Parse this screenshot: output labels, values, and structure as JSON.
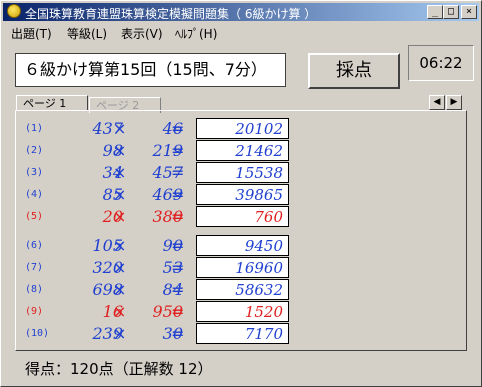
{
  "window": {
    "title": "全国珠算教育連盟珠算検定模擬問題集（ 6級かけ算 ）",
    "min_glyph": "_",
    "max_glyph": "□",
    "close_glyph": "×"
  },
  "menu": [
    "出題(T)",
    "等級(L)",
    "表示(V)",
    "ﾍﾙﾌﾟ(H)"
  ],
  "header": {
    "title": "６級かけ算第15回（15問、7分）",
    "score_button": "採点",
    "timer": "06:22"
  },
  "tabs": [
    {
      "label": "ページ 1",
      "active": true
    },
    {
      "label": "ページ 2",
      "active": false
    }
  ],
  "nav": {
    "left": "◀",
    "right": "▶"
  },
  "symbols": {
    "times": "×",
    "equals": "="
  },
  "problems": [
    {
      "num": "(1)",
      "a": "437",
      "b": "46",
      "answer": "20102",
      "color": "blue"
    },
    {
      "num": "(2)",
      "a": "98",
      "b": "219",
      "answer": "21462",
      "color": "blue"
    },
    {
      "num": "(3)",
      "a": "34",
      "b": "457",
      "answer": "15538",
      "color": "blue"
    },
    {
      "num": "(4)",
      "a": "85",
      "b": "469",
      "answer": "39865",
      "color": "blue"
    },
    {
      "num": "(5)",
      "a": "20",
      "b": "380",
      "answer": "760",
      "color": "red"
    },
    {
      "num": "(6)",
      "a": "105",
      "b": "90",
      "answer": "9450",
      "color": "blue"
    },
    {
      "num": "(7)",
      "a": "320",
      "b": "53",
      "answer": "16960",
      "color": "blue"
    },
    {
      "num": "(8)",
      "a": "698",
      "b": "84",
      "answer": "58632",
      "color": "blue"
    },
    {
      "num": "(9)",
      "a": "16",
      "b": "950",
      "answer": "1520",
      "color": "red"
    },
    {
      "num": "(10)",
      "a": "239",
      "b": "30",
      "answer": "7170",
      "color": "blue"
    }
  ],
  "status": "得点：120点（正解数 12）"
}
